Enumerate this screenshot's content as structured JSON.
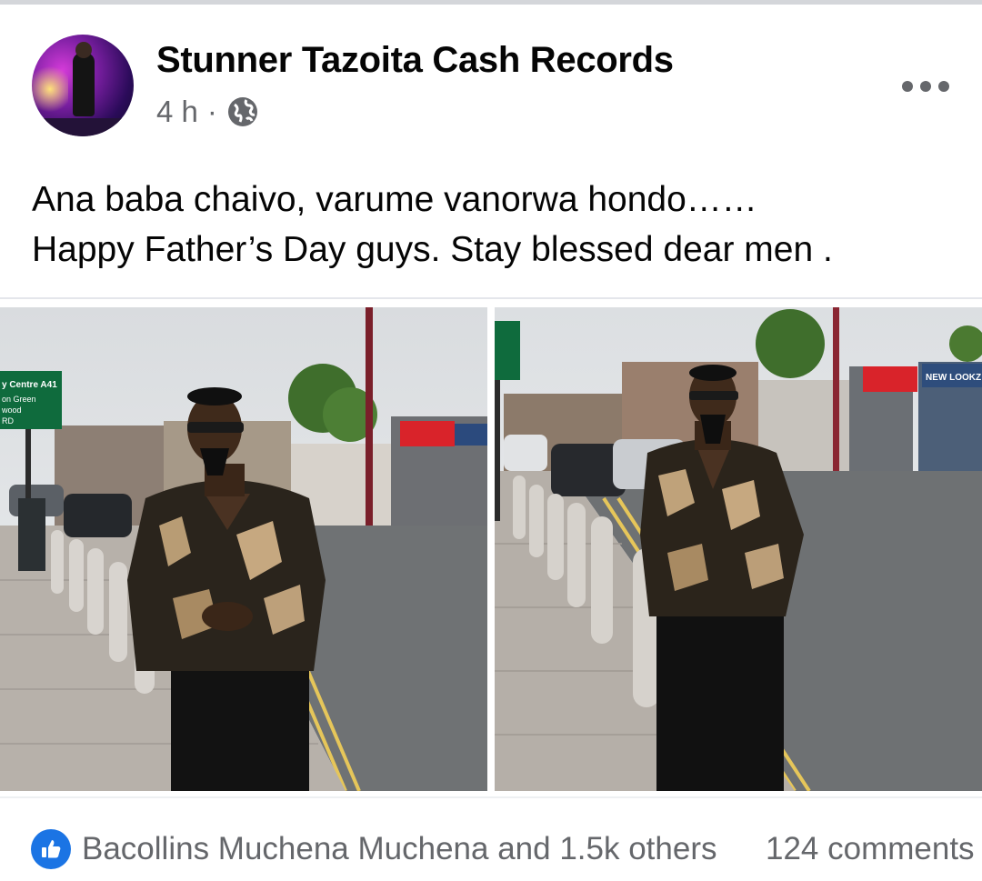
{
  "post": {
    "page_name": "Stunner Tazoita Cash Records",
    "time": "4 h",
    "separator": "·",
    "audience_icon": "globe-icon",
    "more_icon": "more-dots-icon",
    "caption_lines": [
      "Ana baba chaivo, varume vanorwa hondo……",
      "Happy Father’s Day guys. Stay blessed dear men ."
    ]
  },
  "photos": [
    {
      "name": "photo-left",
      "icon": "photo"
    },
    {
      "name": "photo-right",
      "icon": "photo"
    }
  ],
  "photo_signs": {
    "left_sign": [
      "y Centre A41",
      "on Green",
      "wood",
      "RD"
    ],
    "right_shop": "NEW LOOKZ"
  },
  "reactions": {
    "icon": "like-icon",
    "text": "Bacollins Muchena Muchena and 1.5k others",
    "comments": "124 comments"
  },
  "colors": {
    "accent": "#1b74e4",
    "meta_text": "#65676b",
    "text": "#050505"
  }
}
